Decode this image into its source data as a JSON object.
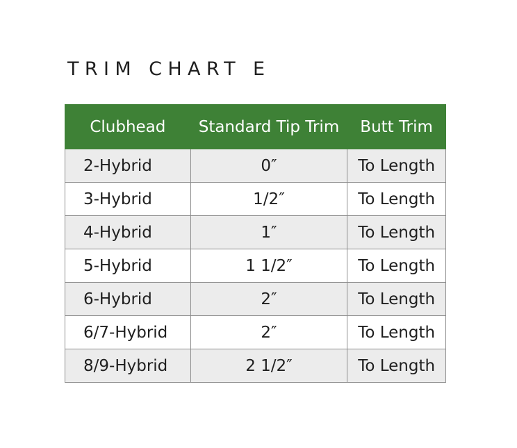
{
  "title": "TRIM CHART E",
  "table": {
    "headers": [
      "Clubhead",
      "Standard Tip Trim",
      "Butt Trim"
    ],
    "rows": [
      [
        "2-Hybrid",
        "0″",
        "To Length"
      ],
      [
        "3-Hybrid",
        "1/2″",
        "To Length"
      ],
      [
        "4-Hybrid",
        "1″",
        "To Length"
      ],
      [
        "5-Hybrid",
        "1 1/2″",
        "To Length"
      ],
      [
        "6-Hybrid",
        "2″",
        "To Length"
      ],
      [
        "6/7-Hybrid",
        "2″",
        "To Length"
      ],
      [
        "8/9-Hybrid",
        "2 1/2″",
        "To Length"
      ]
    ]
  },
  "colors": {
    "header_bg": "#3e8136",
    "header_text": "#ffffff",
    "row_alt_bg": "#ececec",
    "row_bg": "#ffffff",
    "border": "#8c8c8c"
  }
}
